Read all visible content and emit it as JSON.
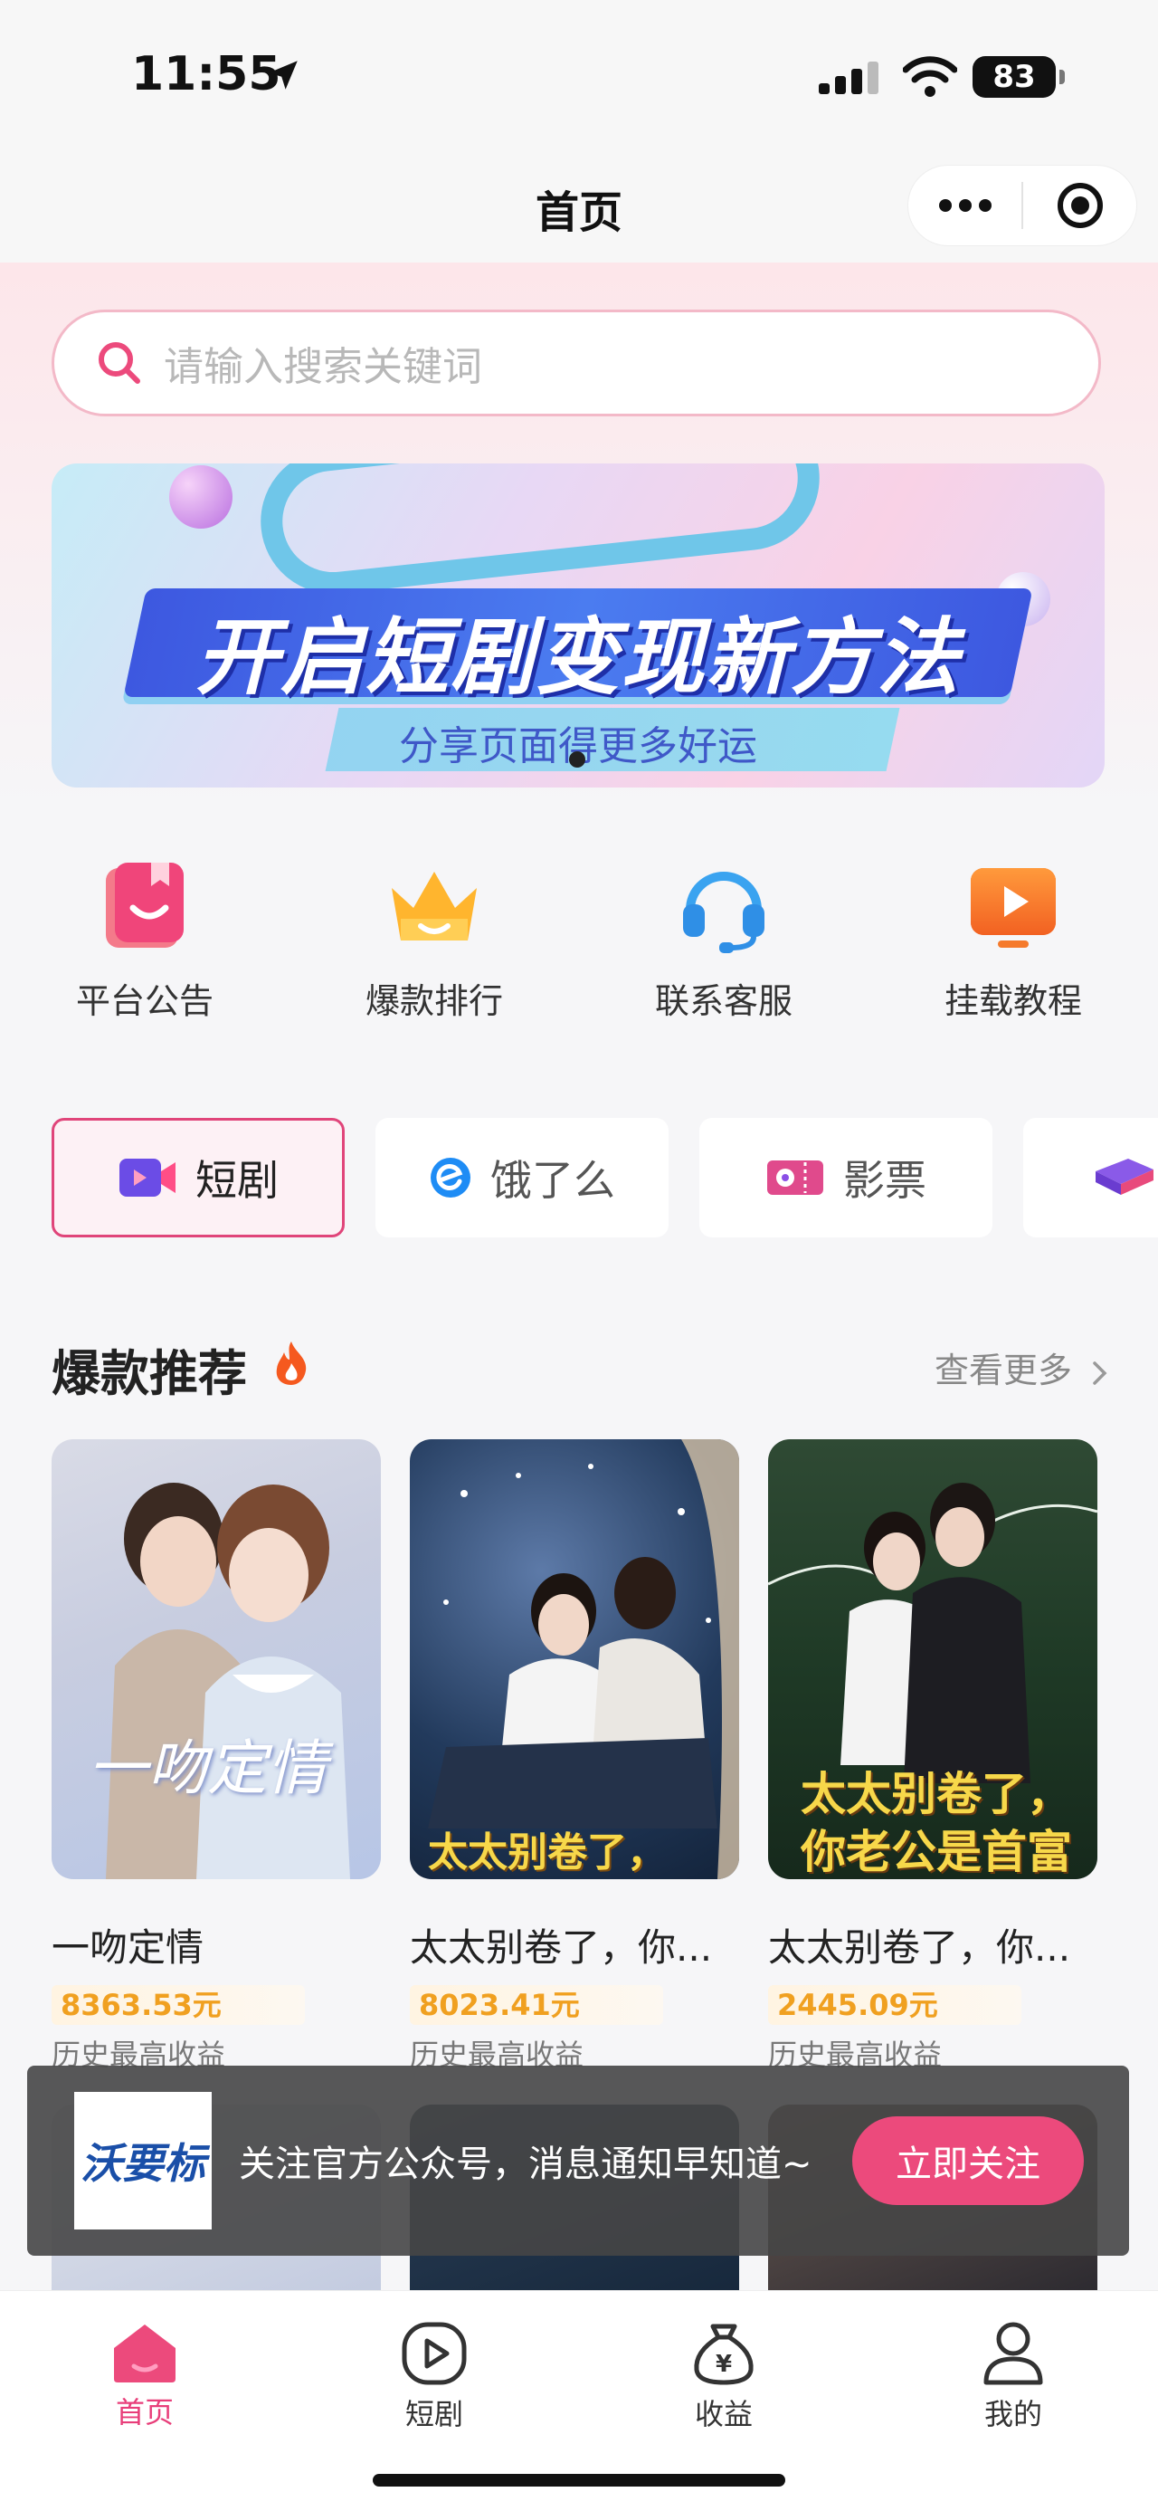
{
  "status_bar": {
    "time": "11:55",
    "battery": "83"
  },
  "nav": {
    "title": "首页"
  },
  "search": {
    "placeholder": "请输入搜索关键词"
  },
  "banner": {
    "title": "开启短剧变现新方法",
    "subtitle": "分享页面得更多好运"
  },
  "quick_links": [
    {
      "label": "平台公告",
      "icon": "bookmark-smile-icon"
    },
    {
      "label": "爆款排行",
      "icon": "crown-icon"
    },
    {
      "label": "联系客服",
      "icon": "headset-icon"
    },
    {
      "label": "挂载教程",
      "icon": "video-play-icon"
    }
  ],
  "categories": [
    {
      "label": "短剧",
      "icon": "video-camera-icon",
      "active": true
    },
    {
      "label": "饿了么",
      "icon": "eleme-icon",
      "active": false
    },
    {
      "label": "影票",
      "icon": "movie-ticket-icon",
      "active": false
    }
  ],
  "section": {
    "title": "爆款推荐",
    "more": "查看更多"
  },
  "cards": [
    {
      "title": "一吻定情",
      "amount": "8363.53元",
      "note": "历史最高收益",
      "poster_text": "一吻定情"
    },
    {
      "title": "太太别卷了，你...",
      "amount": "8023.41元",
      "note": "历史最高收益",
      "poster_text": "太太别卷了，"
    },
    {
      "title": "太太别卷了，你...",
      "amount": "2445.09元",
      "note": "历史最高收益",
      "poster_text": "太太别卷了，你老公是首富"
    }
  ],
  "follow_bar": {
    "logo": "沃要标",
    "text": "关注官方公众号，消息通知早知道~",
    "button": "立即关注"
  },
  "tabbar": [
    {
      "label": "首页",
      "icon": "home-icon",
      "active": true
    },
    {
      "label": "短剧",
      "icon": "play-circle-icon",
      "active": false
    },
    {
      "label": "收益",
      "icon": "money-bag-icon",
      "active": false
    },
    {
      "label": "我的",
      "icon": "user-icon",
      "active": false
    }
  ],
  "colors": {
    "accent": "#e83e7a",
    "amount": "#f0a020"
  }
}
